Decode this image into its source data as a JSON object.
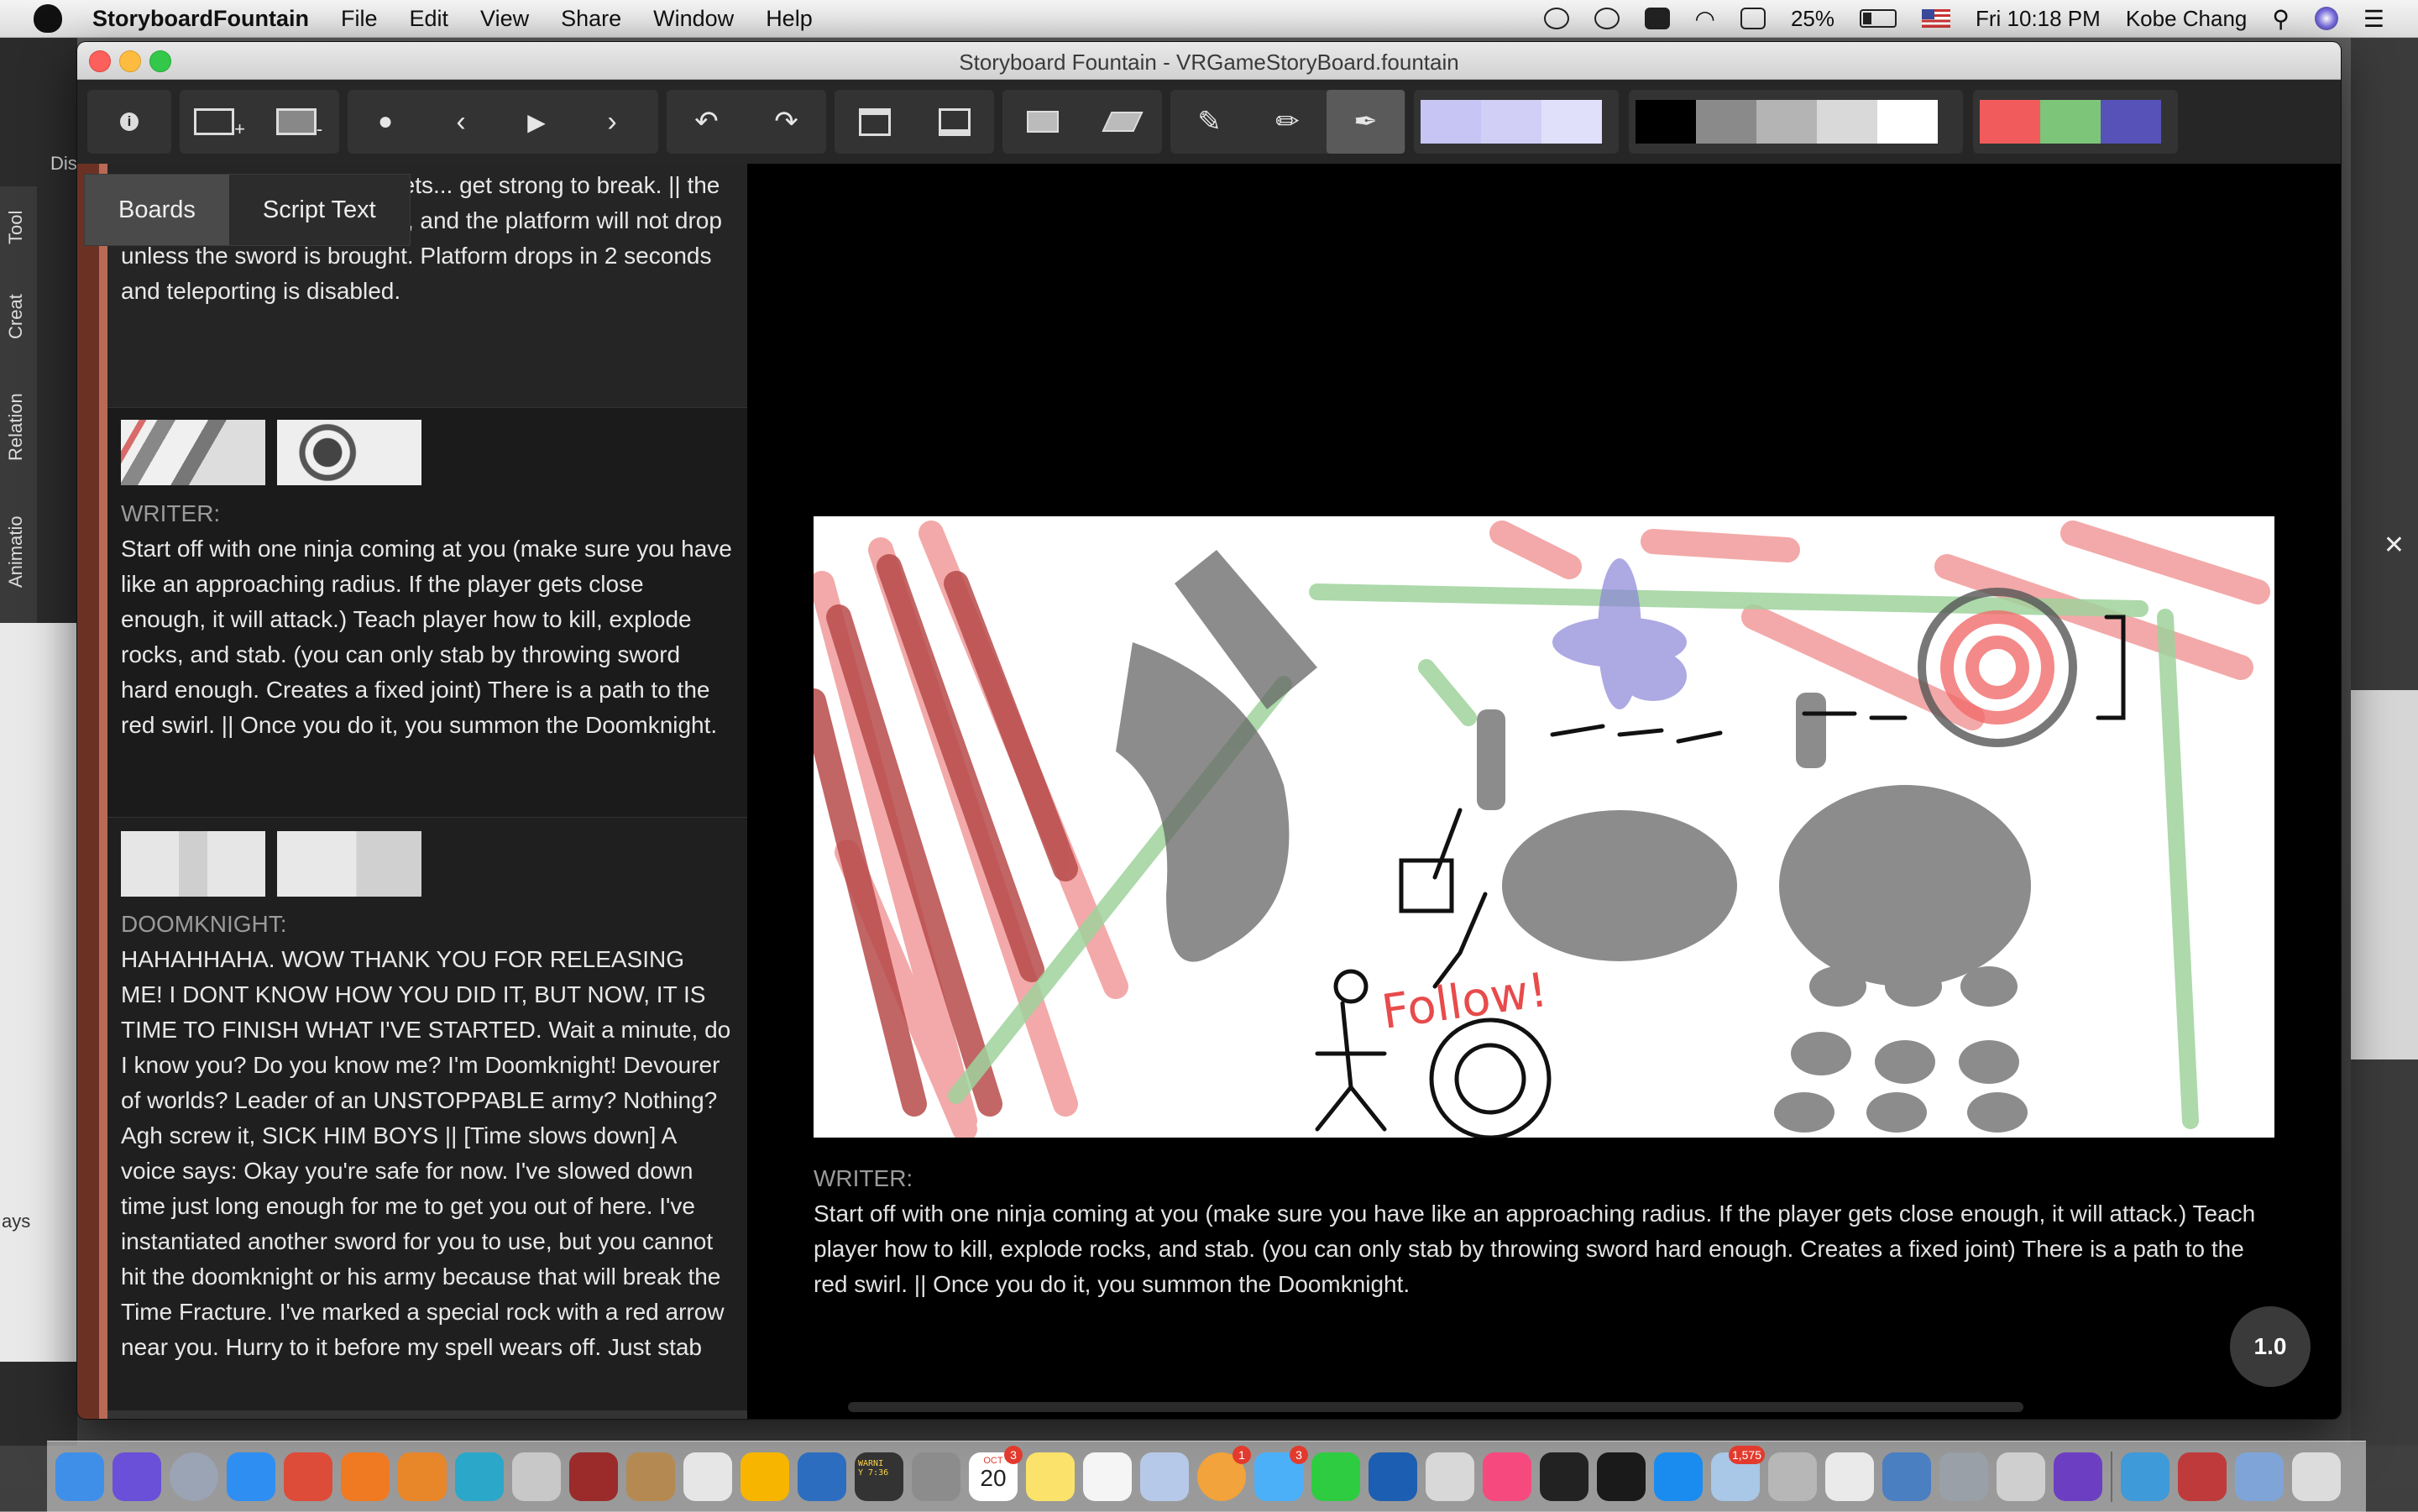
{
  "menubar": {
    "app_name": "StoryboardFountain",
    "items": [
      "File",
      "Edit",
      "View",
      "Share",
      "Window",
      "Help"
    ],
    "battery": "25%",
    "clock": "Fri 10:18 PM",
    "user": "Kobe Chang"
  },
  "window": {
    "title": "Storyboard Fountain - VRGameStoryBoard.fountain"
  },
  "background": {
    "left_tabs": [
      "Tool",
      "Creat",
      "Relation",
      "Animatio"
    ],
    "left_partial_text": "ays",
    "left_partial_label_dis": "Dis"
  },
  "toolbar": {
    "icons": [
      "info-icon",
      "add-board-icon",
      "remove-board-icon",
      "record-dot-icon",
      "previous-icon",
      "play-icon",
      "next-icon",
      "undo-icon",
      "redo-icon",
      "tray-up-icon",
      "tray-down-icon",
      "light-table-icon",
      "flip-icon",
      "brush-icon",
      "pencil-icon",
      "pen-icon"
    ],
    "swatches_light": [
      "#c7c5f3",
      "#d1cff6",
      "#e1e0fb"
    ],
    "swatches_gray": [
      "#000000",
      "#8a8a8a",
      "#b4b4b4",
      "#d9d9d9",
      "#ffffff"
    ],
    "swatches_color": [
      "#f25b5b",
      "#7dc578",
      "#5652b8"
    ]
  },
  "left_panel": {
    "tabs": [
      "Boards",
      "Script Text"
    ],
    "scenes": [
      {
        "label": "",
        "text": "you swing, the stronger it gets... get strong to break. || the player has to move to the X, and the platform will not drop unless the sword is brought. Platform drops in 2 seconds and teleporting is disabled."
      },
      {
        "label": "WRITER:",
        "text": "Start off with one ninja coming at you (make sure you have like an approaching radius. If the player gets close enough, it will attack.) Teach player how to kill, explode rocks, and stab. (you can only stab by throwing sword hard enough. Creates a fixed joint) There is a path to the red swirl. || Once you do it, you summon the Doomknight."
      },
      {
        "label": "DOOMKNIGHT:",
        "text": "HAHAHHAHA. WOW THANK YOU FOR RELEASING ME! I DONT KNOW HOW YOU DID IT, BUT NOW, IT IS TIME TO FINISH WHAT I'VE STARTED. Wait a minute, do I know you? Do you know me? I'm Doomknight! Devourer of worlds? Leader of an UNSTOPPABLE army? Nothing? Agh screw it, SICK HIM BOYS || [Time slows down] A voice says: Okay you're safe for now. I've slowed down time just long enough for me to get you out of here. I've instantiated another sword for you to use, but you cannot hit the doomknight or his army because that will break the Time Fracture. I've marked a special rock with a red arrow near you. Hurry to it before my spell wears off. Just stab"
      }
    ]
  },
  "main_panel": {
    "board_caption": "Follow!",
    "dialogue_label": "WRITER:",
    "dialogue_text": "Start off with one ninja coming at you (make sure you have like an approaching radius. If the player gets close enough, it will attack.) Teach player how to kill, explode rocks, and stab. (you can only stab by throwing sword hard enough. Creates a fixed joint) There is a path to the red swirl. || Once you do it, you summon the Doomknight.",
    "speed": "1.0"
  },
  "dock": {
    "icons": [
      {
        "name": "finder-icon",
        "color": "#3f8fe8"
      },
      {
        "name": "siri-icon",
        "color": "#6a4fd8"
      },
      {
        "name": "launchpad-icon",
        "color": "#9aa4b5"
      },
      {
        "name": "safari-icon",
        "color": "#2f8ef2"
      },
      {
        "name": "chrome-icon",
        "color": "#dd4b39"
      },
      {
        "name": "firefox-icon",
        "color": "#ef7a22"
      },
      {
        "name": "blender-icon",
        "color": "#e8862a"
      },
      {
        "name": "maya-icon",
        "color": "#2aa7c9"
      },
      {
        "name": "steam-icon",
        "color": "#c8c8c8"
      },
      {
        "name": "dictionary-icon",
        "color": "#9b2b2b"
      },
      {
        "name": "contacts-icon",
        "color": "#b58a52"
      },
      {
        "name": "sublime-icon",
        "color": "#e6e6e6"
      },
      {
        "name": "sketch-icon",
        "color": "#f7b500"
      },
      {
        "name": "sourcetree-icon",
        "color": "#2d6dbf"
      },
      {
        "name": "console-icon",
        "color": "#333333"
      },
      {
        "name": "preferences-icon",
        "color": "#8c8c8c"
      },
      {
        "name": "calendar-icon",
        "color": "#ffffff"
      },
      {
        "name": "notes-icon",
        "color": "#fbe26a"
      },
      {
        "name": "reminders-icon",
        "color": "#f5f5f5"
      },
      {
        "name": "preview-icon",
        "color": "#b7c9e8"
      },
      {
        "name": "photos-icon",
        "color": "#f2a33b"
      },
      {
        "name": "messages-icon",
        "color": "#4cb0f9"
      },
      {
        "name": "facetime-icon",
        "color": "#2ecc40"
      },
      {
        "name": "battlenet-icon",
        "color": "#1c5fb2"
      },
      {
        "name": "media-icon",
        "color": "#d8d8d8"
      },
      {
        "name": "music-icon",
        "color": "#f64a7f"
      },
      {
        "name": "unity-icon",
        "color": "#222222"
      },
      {
        "name": "epic-games-icon",
        "color": "#1a1a1a"
      },
      {
        "name": "app-store-icon",
        "color": "#1a8cf0"
      },
      {
        "name": "mail-icon",
        "color": "#a9c7e6"
      },
      {
        "name": "archive-icon",
        "color": "#b7b7b7"
      },
      {
        "name": "text-edit-icon",
        "color": "#eaeaea"
      },
      {
        "name": "network-icon",
        "color": "#4a7fc1"
      },
      {
        "name": "disk-utility-icon",
        "color": "#9aa0a8"
      },
      {
        "name": "font-book-icon",
        "color": "#cfcfcf"
      },
      {
        "name": "imovie-icon",
        "color": "#6c3fc2"
      },
      {
        "name": "sync-icon",
        "color": "#3e9ad8"
      },
      {
        "name": "photo-booth-icon",
        "color": "#bf3b3b"
      },
      {
        "name": "downloads-icon",
        "color": "#7fa4d8"
      },
      {
        "name": "trash-icon",
        "color": "#dcdcdc"
      }
    ],
    "calendar_day": "20",
    "calendar_month": "OCT",
    "badges": {
      "calendar": "3",
      "photos": "1",
      "messages": "3",
      "mail": "1,575"
    },
    "console_text": "WARNI\nY 7:36"
  }
}
